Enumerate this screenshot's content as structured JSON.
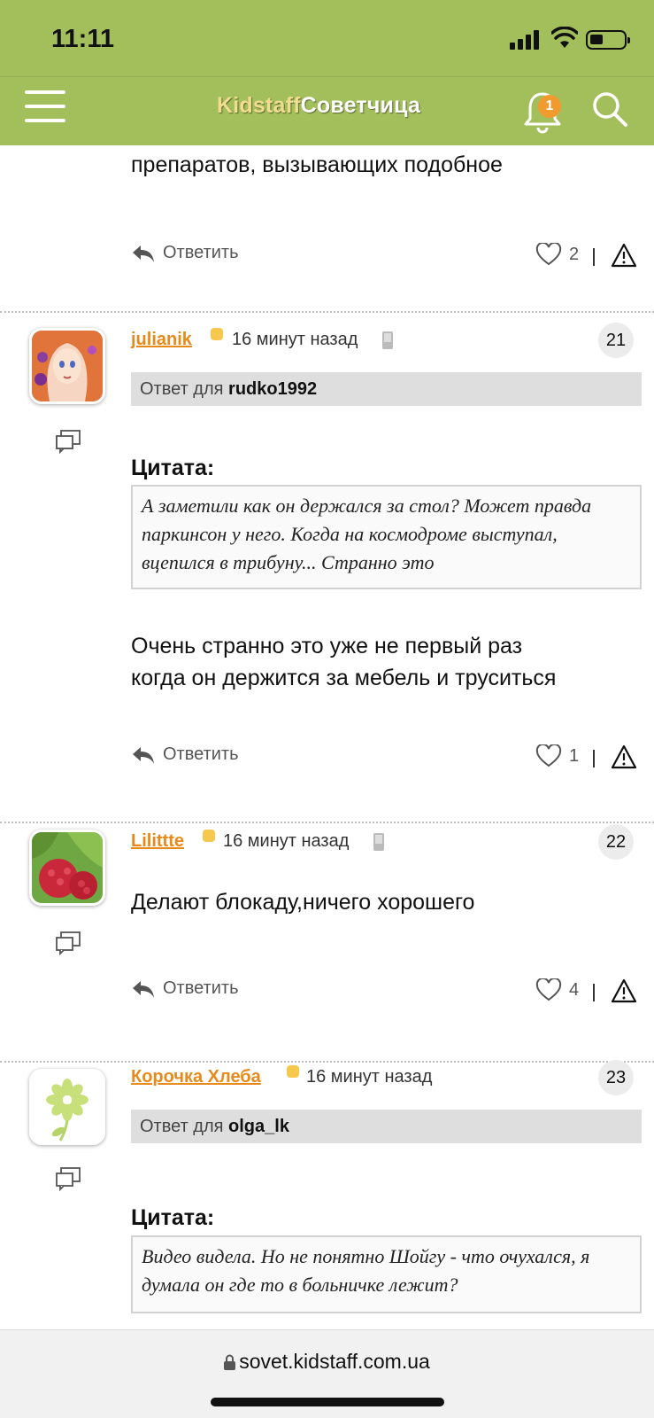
{
  "status_bar": {
    "time": "11:11"
  },
  "header": {
    "brand_part1": "Kidstaff",
    "brand_part2": "Советчица",
    "notifications_count": "1"
  },
  "colors": {
    "header_bg": "#a3bf5c",
    "author": "#e88a1a",
    "badge": "#f19a2e"
  },
  "icons": [
    "menu-icon",
    "bell-icon",
    "search-icon",
    "reply-arrow-icon",
    "heart-icon",
    "warning-icon",
    "quote-icon",
    "mobile-device-icon",
    "lock-icon"
  ],
  "prev_post": {
    "text_tail": "препаратов, вызывающих подобное",
    "reply_label": "Ответить",
    "likes": "2"
  },
  "posts": [
    {
      "author": "julianik",
      "time": "16 минут назад",
      "number": "21",
      "reply_prefix": "Ответ для",
      "reply_to": "rudko1992",
      "quote_title": "Цитата:",
      "quote": "А заметили как он держался за стол? Может правда паркинсон у него. Когда на космодроме выступал, вцепился в трибуну... Странно это",
      "text_line1": "Очень странно это уже не первый раз",
      "text_line2": "когда он держится за мебель и труситься",
      "reply_label": "Ответить",
      "likes": "1"
    },
    {
      "author": "Lilittte",
      "time": "16 минут назад",
      "number": "22",
      "text_line1": "Делают блокаду,ничего хорошего",
      "reply_label": "Ответить",
      "likes": "4"
    },
    {
      "author": "Корочка Хлеба",
      "time": "16 минут назад",
      "number": "23",
      "reply_prefix": "Ответ для",
      "reply_to": "olga_lk",
      "quote_title": "Цитата:",
      "quote": "Видео видела. Но не понятно Шойгу - что очухался, я думала он где то в больничке лежит?"
    }
  ],
  "url_bar": {
    "url": "sovet.kidstaff.com.ua"
  }
}
